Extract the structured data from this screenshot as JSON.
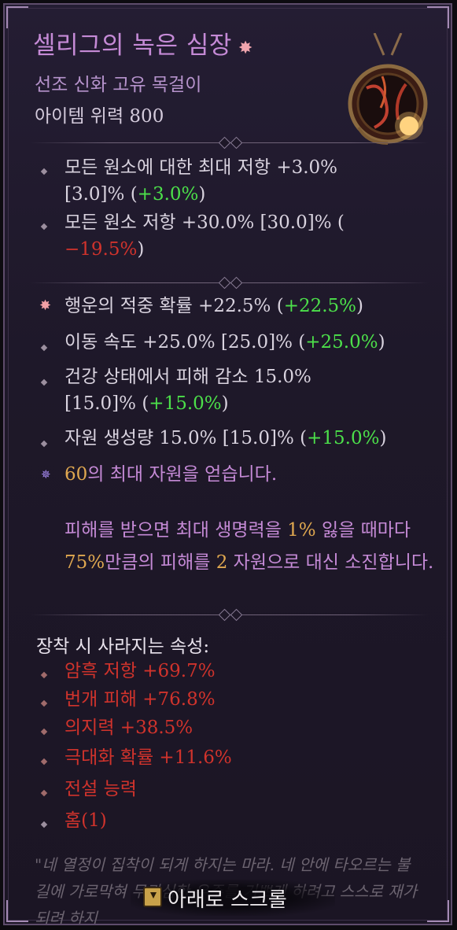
{
  "item": {
    "name": "셀리그의 녹은 심장",
    "name_star": "✸",
    "type": "선조 신화 고유 목걸이",
    "power_label": "아이템 위력 800"
  },
  "affixes": [
    {
      "l1a": "모든 원소에 대한 최대 저항 +3.0%",
      "l2a": "[3.0]% (",
      "l2b": "+3.0%",
      "l2c": ")"
    },
    {
      "l1a": "모든 원소 저항 +30.0% [30.0]% (",
      "l2b": "−19.5%",
      "l2c": ")"
    }
  ],
  "greater": [
    {
      "a": "행운의 적중 확률 +22.5% (",
      "b": "+22.5%",
      "c": ")"
    },
    {
      "a": "이동 속도 +25.0% [25.0]% (",
      "b": "+25.0%",
      "c": ")"
    },
    {
      "a": "건강 상태에서 피해 감소 15.0%",
      "a2": "[15.0]% (",
      "b": "+15.0%",
      "c": ")"
    },
    {
      "a": "자원 생성량 15.0% [15.0]% (",
      "b": "+15.0%",
      "c": ")"
    }
  ],
  "bonus": {
    "num": "60",
    "text": "의 최대 자원을 얻습니다."
  },
  "unique": {
    "p1": "피해를 받으면 최대 생명력을 ",
    "v1": "1%",
    "p2": " 잃을 때마다 ",
    "v2": "75%",
    "p3": "만큼의 피해를 ",
    "v3": "2",
    "p4": " 자원으로 대신 소진합니다."
  },
  "lost_header": "장착 시 사라지는 속성:",
  "lost": [
    "암흑 저항 +69.7%",
    "번개 피해 +76.8%",
    "의지력 +38.5%",
    "극대화 확률 +11.6%",
    "전설 능력",
    "홈(1)"
  ],
  "flavor": "\"네 열정이 집착이 되게 하지는 마라. 네 안에 타오르는 불길에 가로막혀 무관심한 우주를 기쁘게 하려고 스스로 재가 되려 하지",
  "scroll_label": "아래로 스크롤",
  "colors": {
    "green": "#4ce04a",
    "red": "#d0332c",
    "gold": "#e0a850",
    "unique": "#c58ad6"
  }
}
